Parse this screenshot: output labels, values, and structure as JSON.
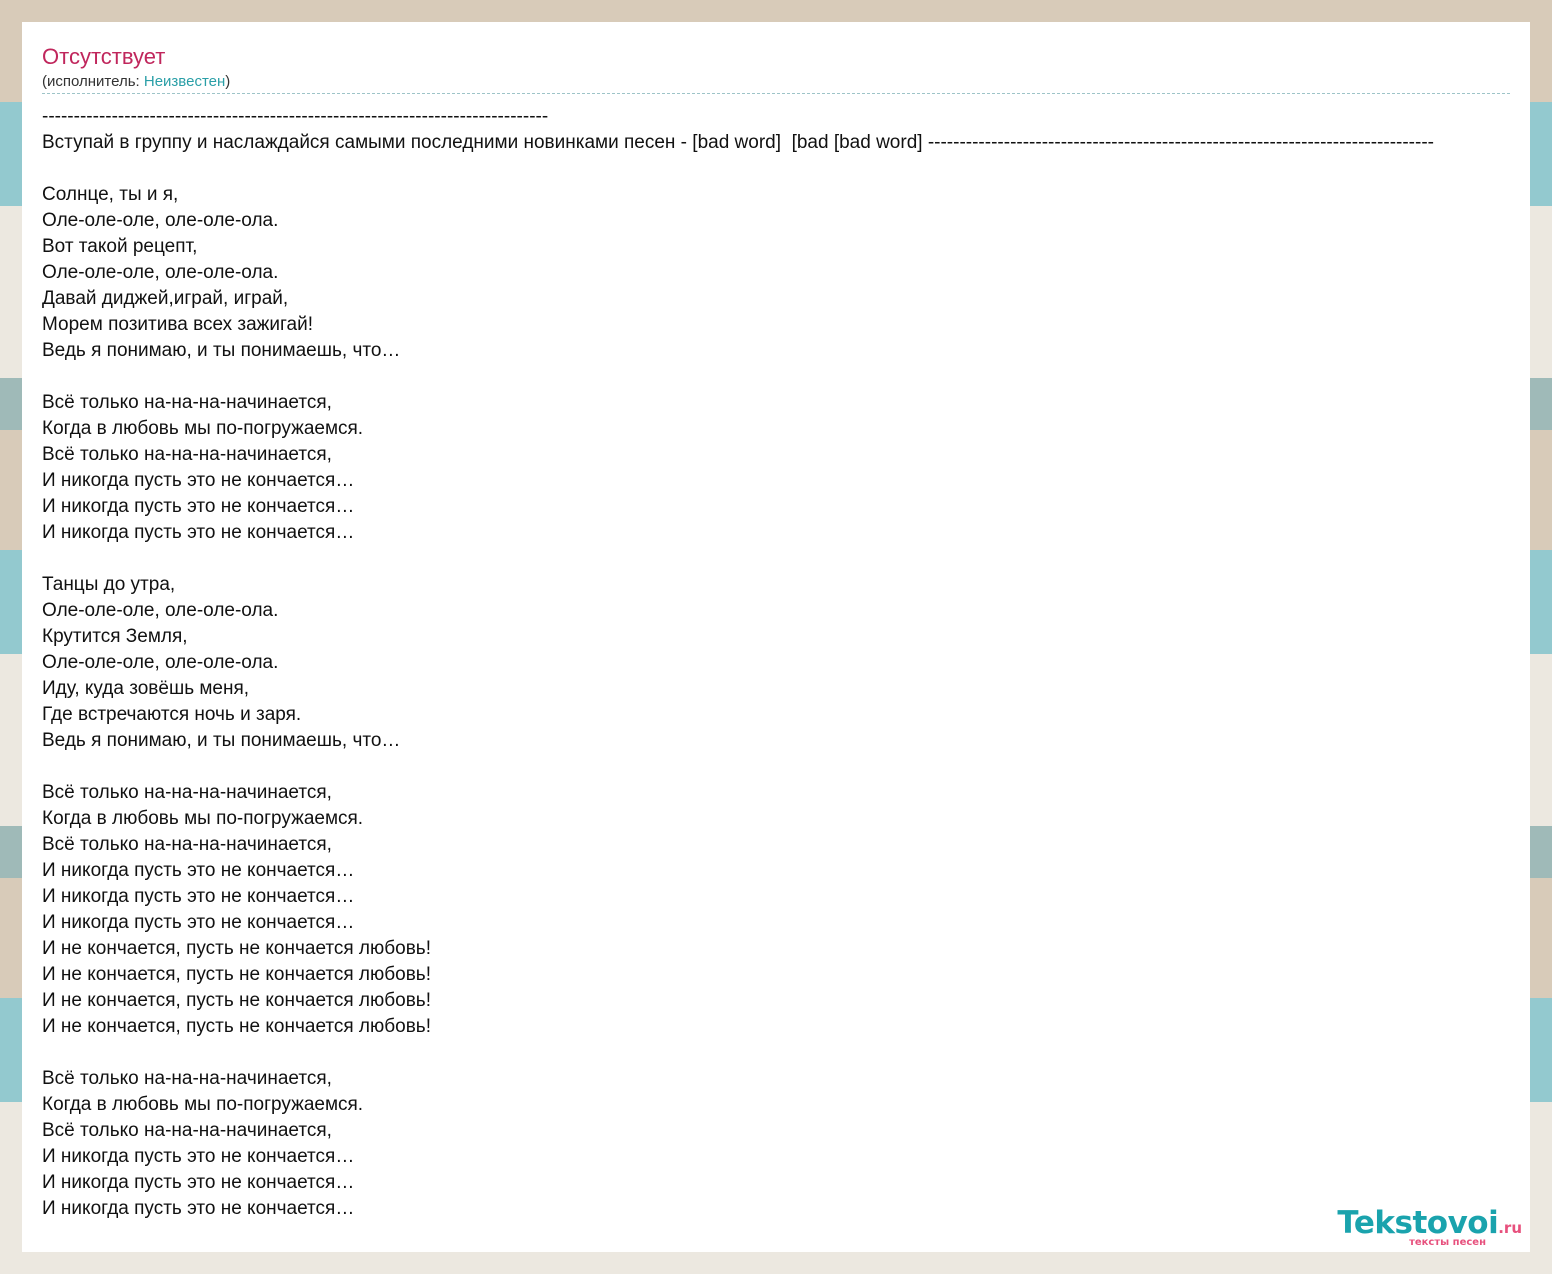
{
  "song": {
    "title": "Отсутствует",
    "artist_prefix": "(исполнитель: ",
    "artist_name": "Неизвестен",
    "artist_suffix": ")"
  },
  "lyrics": [
    "--------------------------------------------------------------------------------",
    "Вступай в группу и наслаждайся самыми последними новинками песен - [bad word]  [bad [bad word] --------------------------------------------------------------------------------",
    "",
    "Солнце, ты и я,",
    "Оле-оле-оле, оле-оле-ола.",
    "Вот такой рецепт,",
    "Оле-оле-оле, оле-оле-ола.",
    "Давай диджей,играй, играй,",
    "Морем позитива всех зажигай!",
    "Ведь я понимаю, и ты понимаешь, что…",
    "",
    "Всё только на-на-на-начинается,",
    "Когда в любовь мы по-погружаемся.",
    "Всё только на-на-на-начинается,",
    "И никогда пусть это не кончается…",
    "И никогда пусть это не кончается…",
    "И никогда пусть это не кончается…",
    "",
    "Танцы до утра,",
    "Оле-оле-оле, оле-оле-ола.",
    "Крутится Земля,",
    "Оле-оле-оле, оле-оле-ола.",
    "Иду, куда зовёшь меня,",
    "Где встречаются ночь и заря.",
    "Ведь я понимаю, и ты понимаешь, что…",
    "",
    "Всё только на-на-на-начинается,",
    "Когда в любовь мы по-погружаемся.",
    "Всё только на-на-на-начинается,",
    "И никогда пусть это не кончается…",
    "И никогда пусть это не кончается…",
    "И никогда пусть это не кончается…",
    "И не кончается, пусть не кончается любовь!",
    "И не кончается, пусть не кончается любовь!",
    "И не кончается, пусть не кончается любовь!",
    "И не кончается, пусть не кончается любовь!",
    "",
    "Всё только на-на-на-начинается,",
    "Когда в любовь мы по-погружаемся.",
    "Всё только на-на-на-начинается,",
    "И никогда пусть это не кончается…",
    "И никогда пусть это не кончается…",
    "И никогда пусть это не кончается…"
  ],
  "logo": {
    "name": "Tekstovoi",
    "tld": ".ru",
    "tagline": "тексты песен",
    "primary_color": "#1aa3ad",
    "accent_color": "#e7507d"
  },
  "colors": {
    "title": "#c0265c",
    "link": "#2a9fa7",
    "text": "#111111"
  }
}
